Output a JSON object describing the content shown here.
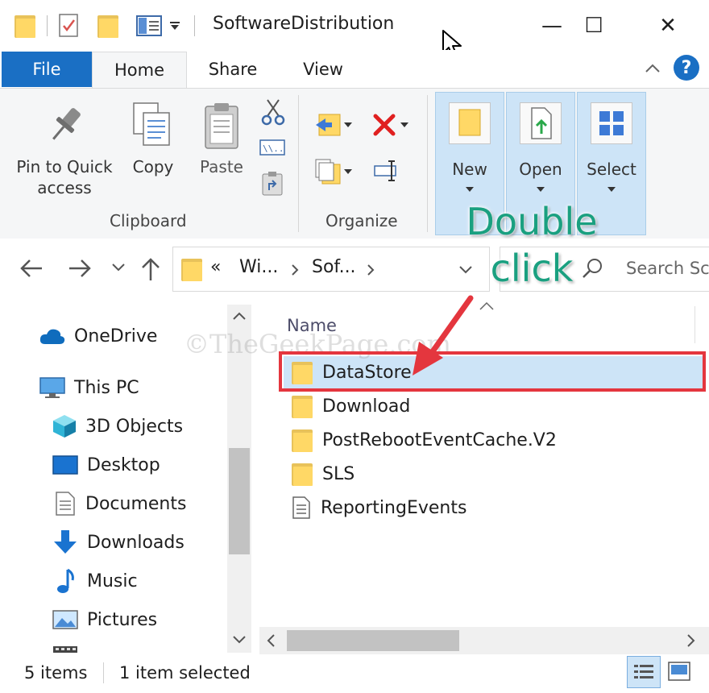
{
  "window": {
    "title": "SoftwareDistribution",
    "minimize_glyph": "—",
    "maximize_glyph": "☐",
    "close_glyph": "✕"
  },
  "ribbon_tabs": {
    "file": "File",
    "home": "Home",
    "share": "Share",
    "view": "View",
    "help": "?"
  },
  "clipboard": {
    "pin_label_1": "Pin to Quick",
    "pin_label_2": "access",
    "copy": "Copy",
    "paste": "Paste",
    "group": "Clipboard"
  },
  "organize": {
    "group": "Organize"
  },
  "new_group": {
    "new": "New",
    "open": "Open",
    "select": "Select"
  },
  "address": {
    "overflow": "«",
    "crumb1": "Wi...",
    "crumb2": "Sof...",
    "search_placeholder": "Search Sc"
  },
  "nav_pane": {
    "items": [
      {
        "label": "OneDrive",
        "icon": "cloud-icon"
      },
      {
        "label": "This PC",
        "icon": "monitor-icon"
      },
      {
        "label": "3D Objects",
        "icon": "cube-icon"
      },
      {
        "label": "Desktop",
        "icon": "desktop-icon"
      },
      {
        "label": "Documents",
        "icon": "document-icon"
      },
      {
        "label": "Downloads",
        "icon": "download-arrow-icon"
      },
      {
        "label": "Music",
        "icon": "music-note-icon"
      },
      {
        "label": "Pictures",
        "icon": "picture-icon"
      }
    ]
  },
  "file_list": {
    "column_name": "Name",
    "files": [
      {
        "name": "DataStore",
        "type": "folder",
        "selected": true
      },
      {
        "name": "Download",
        "type": "folder",
        "selected": false
      },
      {
        "name": "PostRebootEventCache.V2",
        "type": "folder",
        "selected": false
      },
      {
        "name": "SLS",
        "type": "folder",
        "selected": false
      },
      {
        "name": "ReportingEvents",
        "type": "file",
        "selected": false
      }
    ]
  },
  "status": {
    "count": "5 items",
    "selection": "1 item selected"
  },
  "annotation": {
    "line1": "Double",
    "line2": "click",
    "color": "#1aa080",
    "box_color": "#e4363e"
  },
  "watermark": "©TheGeekPage.com",
  "colors": {
    "file_tab": "#1a6fc4",
    "selection": "#cde4f7",
    "folder": "#ffd866"
  }
}
